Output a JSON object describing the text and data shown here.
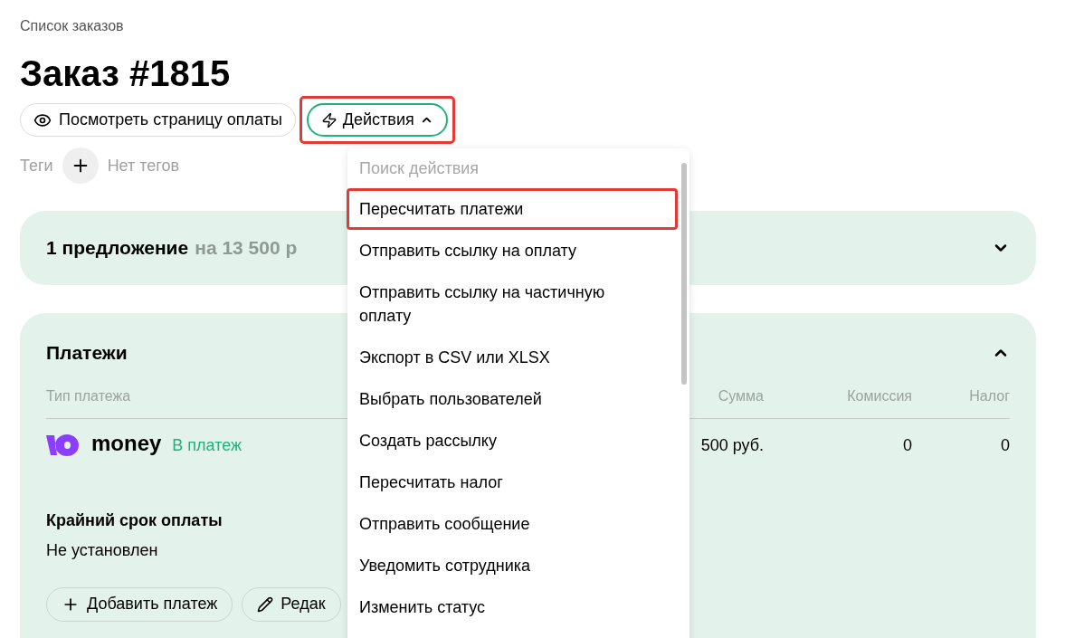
{
  "breadcrumb": "Список заказов",
  "title": "Заказ #1815",
  "header_buttons": [
    {
      "label": "Посмотреть страницу оплаты",
      "kind": "view"
    },
    {
      "label": "Действия",
      "kind": "actions",
      "highlighted": true,
      "expanded": true
    }
  ],
  "tags": {
    "label": "Теги",
    "value": "Нет тегов"
  },
  "offers": {
    "count": "1 предложение",
    "amount": "на 13 500 р",
    "expanded": false
  },
  "payments": {
    "title": "Платежи",
    "expanded": true,
    "columns": [
      "Тип платежа",
      "Сумма",
      "Комиссия",
      "Налог"
    ],
    "rows": [
      {
        "logo": "money",
        "status": "В платеж",
        "sum": "500 руб.",
        "commission": "0",
        "tax": "0"
      }
    ],
    "deadline": {
      "label": "Крайний срок оплаты",
      "value": "Не установлен"
    },
    "buttons": [
      {
        "label": "Добавить платеж",
        "kind": "add"
      },
      {
        "label": "Редак",
        "kind": "edit"
      }
    ]
  },
  "actions_menu": {
    "placeholder": "Поиск действия",
    "items": [
      {
        "label": "Пересчитать платежи",
        "highlighted": true
      },
      {
        "label": "Отправить ссылку на оплату",
        "highlighted": false
      },
      {
        "label": "Отправить ссылку на частичную оплату",
        "highlighted": false
      },
      {
        "label": "Экспорт в CSV или XLSX",
        "highlighted": false
      },
      {
        "label": "Выбрать пользователей",
        "highlighted": false
      },
      {
        "label": "Создать рассылку",
        "highlighted": false
      },
      {
        "label": "Пересчитать налог",
        "highlighted": false
      },
      {
        "label": "Отправить сообщение",
        "highlighted": false
      },
      {
        "label": "Уведомить сотрудника",
        "highlighted": false
      },
      {
        "label": "Изменить статус",
        "highlighted": false
      }
    ]
  }
}
